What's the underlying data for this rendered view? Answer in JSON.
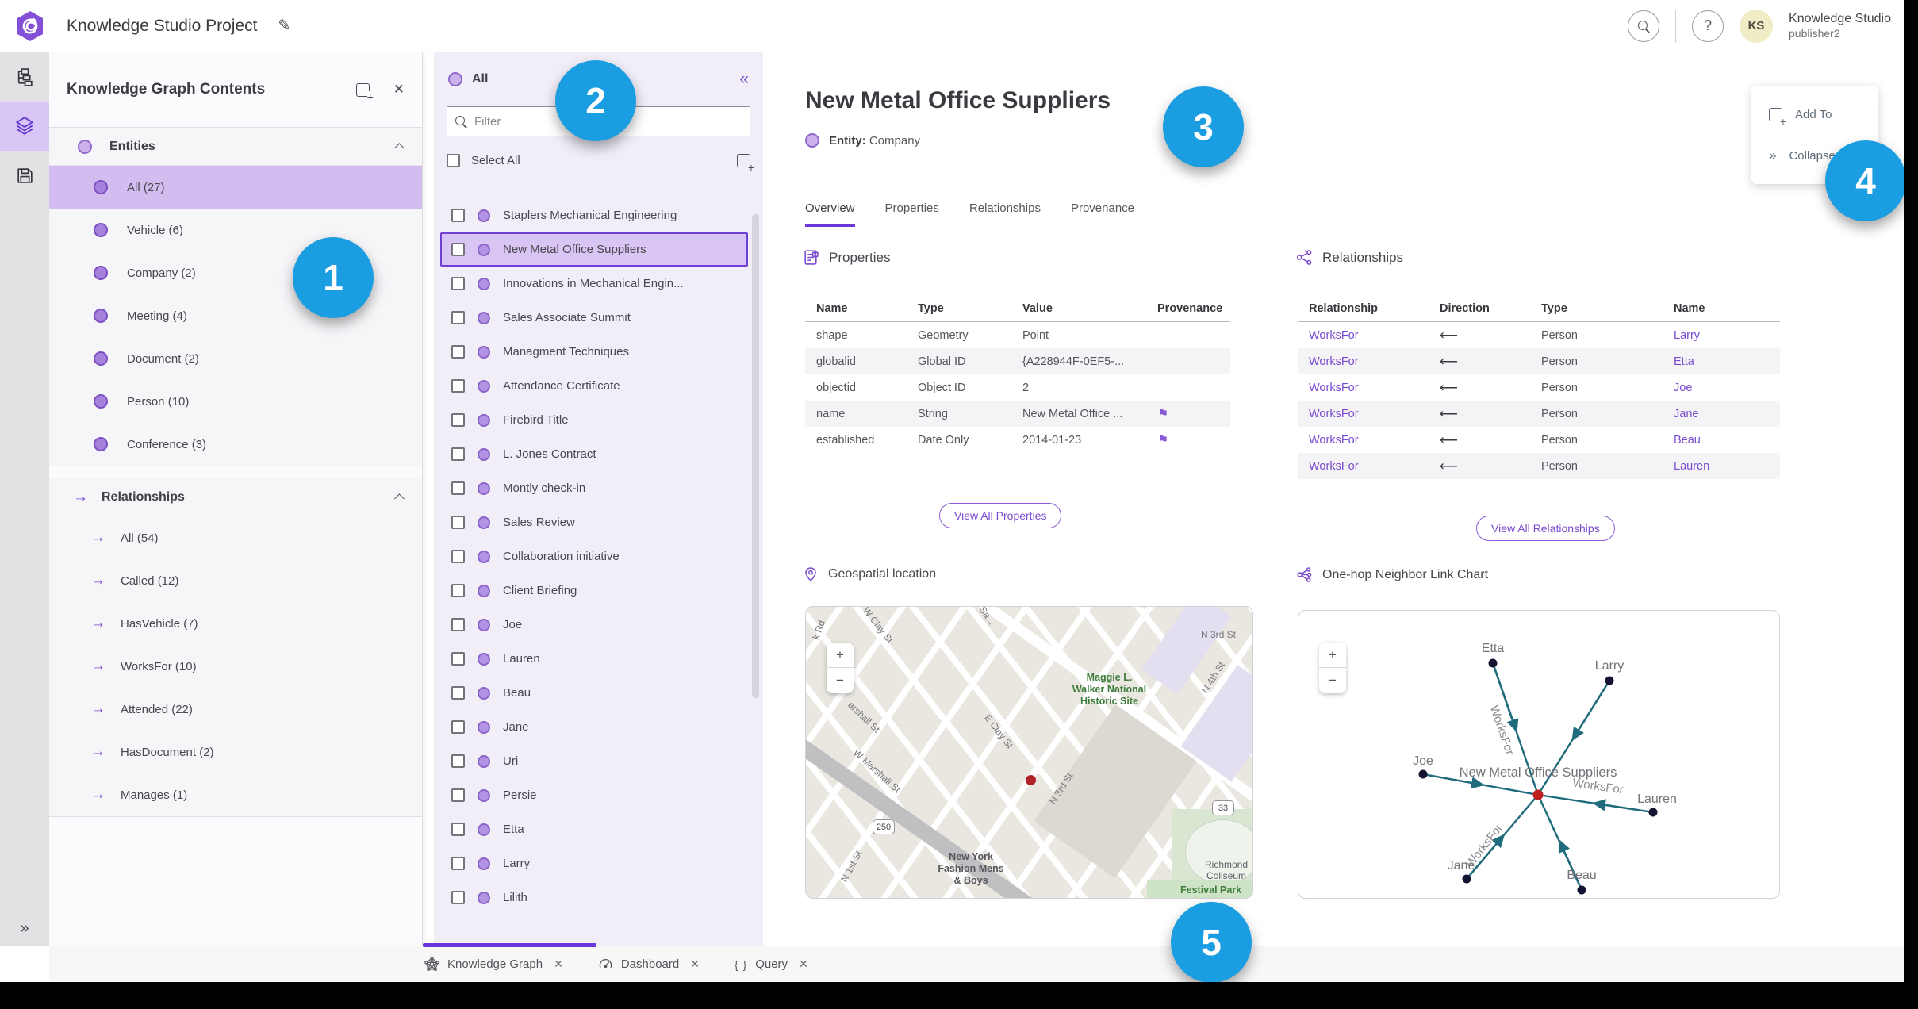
{
  "topbar": {
    "title": "Knowledge Studio Project",
    "user": {
      "initials": "KS",
      "name": "Knowledge Studio",
      "role": "publisher2"
    }
  },
  "contents_panel": {
    "title": "Knowledge Graph Contents",
    "entities": {
      "label": "Entities",
      "items": [
        {
          "label": "All (27)",
          "state": "sel"
        },
        {
          "label": "Vehicle (6)",
          "state": ""
        },
        {
          "label": "Company (2)",
          "state": ""
        },
        {
          "label": "Meeting (4)",
          "state": ""
        },
        {
          "label": "Document (2)",
          "state": ""
        },
        {
          "label": "Person (10)",
          "state": ""
        },
        {
          "label": "Conference (3)",
          "state": ""
        }
      ]
    },
    "relationships": {
      "label": "Relationships",
      "items": [
        {
          "label": "All (54)"
        },
        {
          "label": "Called (12)"
        },
        {
          "label": "HasVehicle (7)"
        },
        {
          "label": "WorksFor (10)"
        },
        {
          "label": "Attended (22)"
        },
        {
          "label": "HasDocument (2)"
        },
        {
          "label": "Manages (1)"
        }
      ]
    }
  },
  "list_panel": {
    "header": "All",
    "filter_placeholder": "Filter",
    "select_all": "Select All",
    "items": [
      {
        "label": "Staplers Mechanical Engineering",
        "state": ""
      },
      {
        "label": "New Metal Office Suppliers",
        "state": "sel"
      },
      {
        "label": "Innovations in Mechanical Engin...",
        "state": ""
      },
      {
        "label": "Sales Associate Summit",
        "state": ""
      },
      {
        "label": "Managment Techniques",
        "state": ""
      },
      {
        "label": "Attendance Certificate",
        "state": ""
      },
      {
        "label": "Firebird Title",
        "state": ""
      },
      {
        "label": "L. Jones Contract",
        "state": ""
      },
      {
        "label": "Montly check-in",
        "state": ""
      },
      {
        "label": "Sales Review",
        "state": ""
      },
      {
        "label": "Collaboration initiative",
        "state": ""
      },
      {
        "label": "Client Briefing",
        "state": ""
      },
      {
        "label": "Joe",
        "state": ""
      },
      {
        "label": "Lauren",
        "state": ""
      },
      {
        "label": "Beau",
        "state": ""
      },
      {
        "label": "Jane",
        "state": ""
      },
      {
        "label": "Uri",
        "state": ""
      },
      {
        "label": "Persie",
        "state": ""
      },
      {
        "label": "Etta",
        "state": ""
      },
      {
        "label": "Larry",
        "state": ""
      },
      {
        "label": "Lilith",
        "state": ""
      }
    ]
  },
  "detail": {
    "title": "New Metal Office Suppliers",
    "entity_label": "Entity:",
    "entity_type": "Company",
    "tabs": [
      {
        "label": "Overview",
        "state": "active"
      },
      {
        "label": "Properties",
        "state": ""
      },
      {
        "label": "Relationships",
        "state": ""
      },
      {
        "label": "Provenance",
        "state": ""
      }
    ],
    "properties": {
      "heading": "Properties",
      "columns": [
        "Name",
        "Type",
        "Value",
        "Provenance"
      ],
      "rows": [
        {
          "name": "shape",
          "type": "Geometry",
          "value": "Point",
          "prov": false,
          "alt": ""
        },
        {
          "name": "globalid",
          "type": "Global ID",
          "value": "{A228944F-0EF5-...",
          "prov": false,
          "alt": "alt"
        },
        {
          "name": "objectid",
          "type": "Object ID",
          "value": "2",
          "prov": false,
          "alt": ""
        },
        {
          "name": "name",
          "type": "String",
          "value": "New Metal Office ...",
          "prov": true,
          "alt": "alt"
        },
        {
          "name": "established",
          "type": "Date Only",
          "value": "2014-01-23",
          "prov": true,
          "alt": ""
        }
      ],
      "view_all": "View All Properties"
    },
    "relationships": {
      "heading": "Relationships",
      "columns": [
        "Relationship",
        "Direction",
        "Type",
        "Name"
      ],
      "rows": [
        {
          "rel": "WorksFor",
          "dir": "⟵",
          "type": "Person",
          "name": "Larry",
          "alt": ""
        },
        {
          "rel": "WorksFor",
          "dir": "⟵",
          "type": "Person",
          "name": "Etta",
          "alt": "alt"
        },
        {
          "rel": "WorksFor",
          "dir": "⟵",
          "type": "Person",
          "name": "Joe",
          "alt": ""
        },
        {
          "rel": "WorksFor",
          "dir": "⟵",
          "type": "Person",
          "name": "Jane",
          "alt": "alt"
        },
        {
          "rel": "WorksFor",
          "dir": "⟵",
          "type": "Person",
          "name": "Beau",
          "alt": ""
        },
        {
          "rel": "WorksFor",
          "dir": "⟵",
          "type": "Person",
          "name": "Lauren",
          "alt": "alt"
        }
      ],
      "view_all": "View All Relationships"
    },
    "map": {
      "heading": "Geospatial location",
      "labels": {
        "k_rd": "k Rd",
        "w_clay": "W Clay St",
        "sa": "Sa...",
        "maggie": "Maggie L.\nWalker National\nHistoric Site",
        "n3rd_top": "N 3rd St",
        "n4th": "N 4th St",
        "marshall_partial": "arshall St",
        "w_marshall": "W Marshall St",
        "e_clay": "E Clay St",
        "n3rd_diag": "N 3rd St",
        "shield250": "250",
        "shield33": "33",
        "ny_fashion": "New York\nFashion Mens\n& Boys",
        "richmond": "Richmond\nColiseum",
        "festival": "Festival Park",
        "n1st": "N 1st St"
      }
    },
    "linkchart": {
      "heading": "One-hop Neighbor Link Chart",
      "center": "New Metal Office Suppliers",
      "edge_label": "WorksFor",
      "nodes": {
        "etta": "Etta",
        "larry": "Larry",
        "joe": "Joe",
        "lauren": "Lauren",
        "jane": "Jane",
        "beau": "Beau"
      }
    }
  },
  "actions": {
    "add_to": "Add To",
    "collapse": "Collapse"
  },
  "bottom_tabs": {
    "kg": "Knowledge Graph",
    "dashboard": "Dashboard",
    "query": "Query"
  },
  "callouts": {
    "c1": "1",
    "c2": "2",
    "c3": "3",
    "c4": "4",
    "c5": "5"
  },
  "icons": {
    "provenance_flag": "⚑",
    "relationship_arrow": "→",
    "collapse_panel": "«",
    "expand_rail": "»",
    "close": "✕",
    "edit": "✎",
    "plus": "+",
    "minus": "−",
    "query_braces": "{ }",
    "question": "?"
  },
  "colors": {
    "accent_purple": "#7a4bd0",
    "selected_purple": "#d3bdf0",
    "callout_blue": "#1b9de2",
    "edge_teal": "#1f6b7c",
    "node_dark": "#141432",
    "center_node_red": "#c0201c"
  }
}
